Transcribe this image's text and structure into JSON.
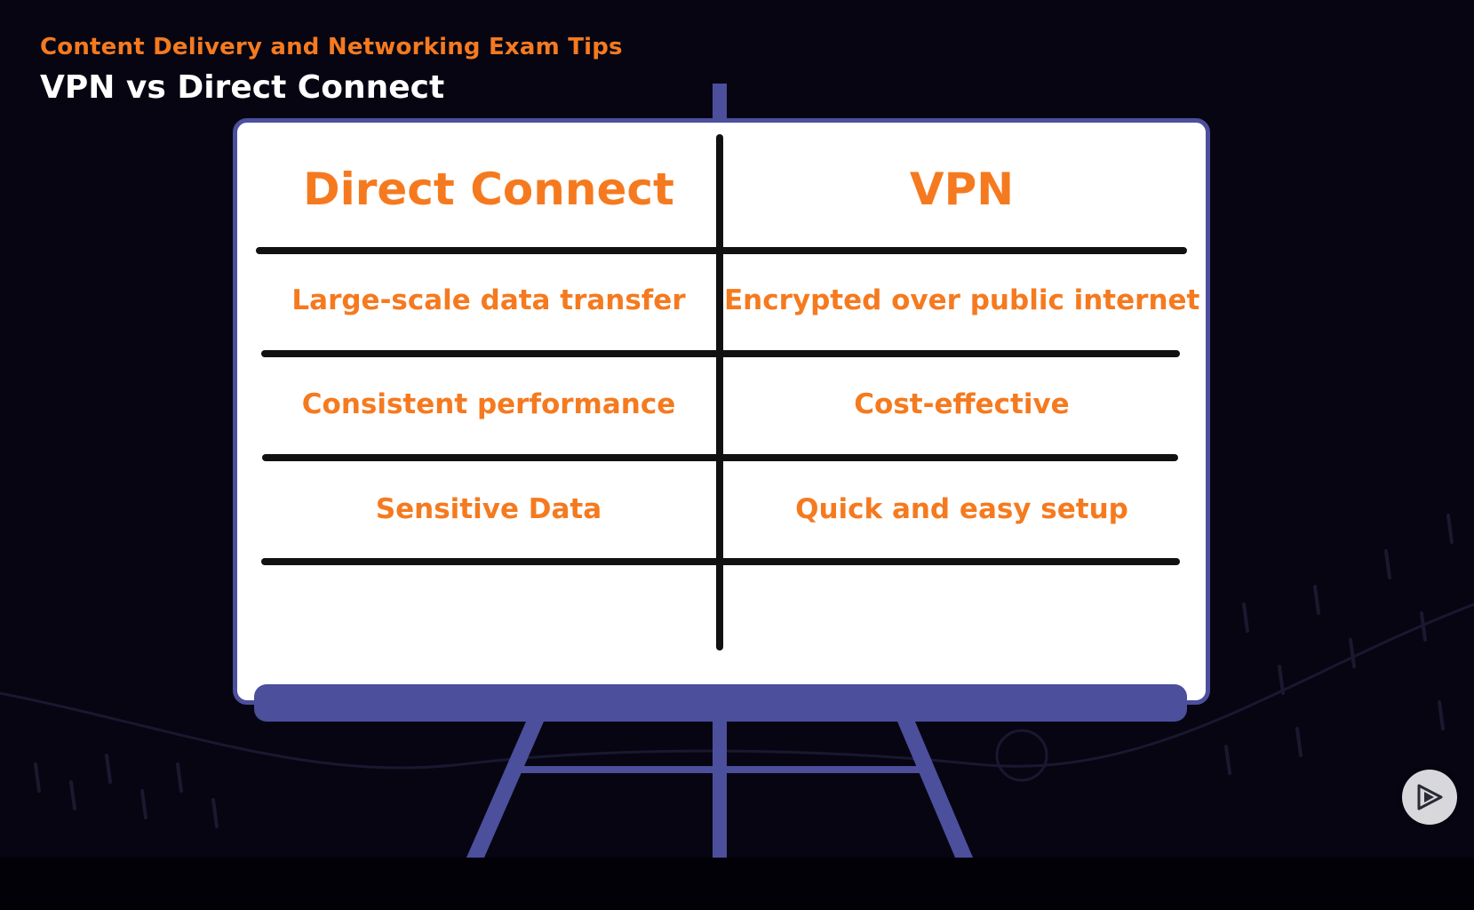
{
  "header": {
    "subtitle": "Content Delivery and Networking Exam Tips",
    "title": "VPN vs Direct Connect"
  },
  "board": {
    "columns": [
      "Direct Connect",
      "VPN"
    ],
    "rows": [
      [
        "Large-scale data transfer",
        "Encrypted over public internet"
      ],
      [
        "Consistent performance",
        "Cost-effective"
      ],
      [
        "Sensitive Data",
        "Quick and easy setup"
      ]
    ]
  },
  "icons": {
    "play": "play-logo-icon"
  },
  "colors": {
    "background": "#070512",
    "accent": "#f57a1f",
    "easel": "#4b4f9c",
    "board": "#ffffff",
    "lines": "#111111"
  }
}
